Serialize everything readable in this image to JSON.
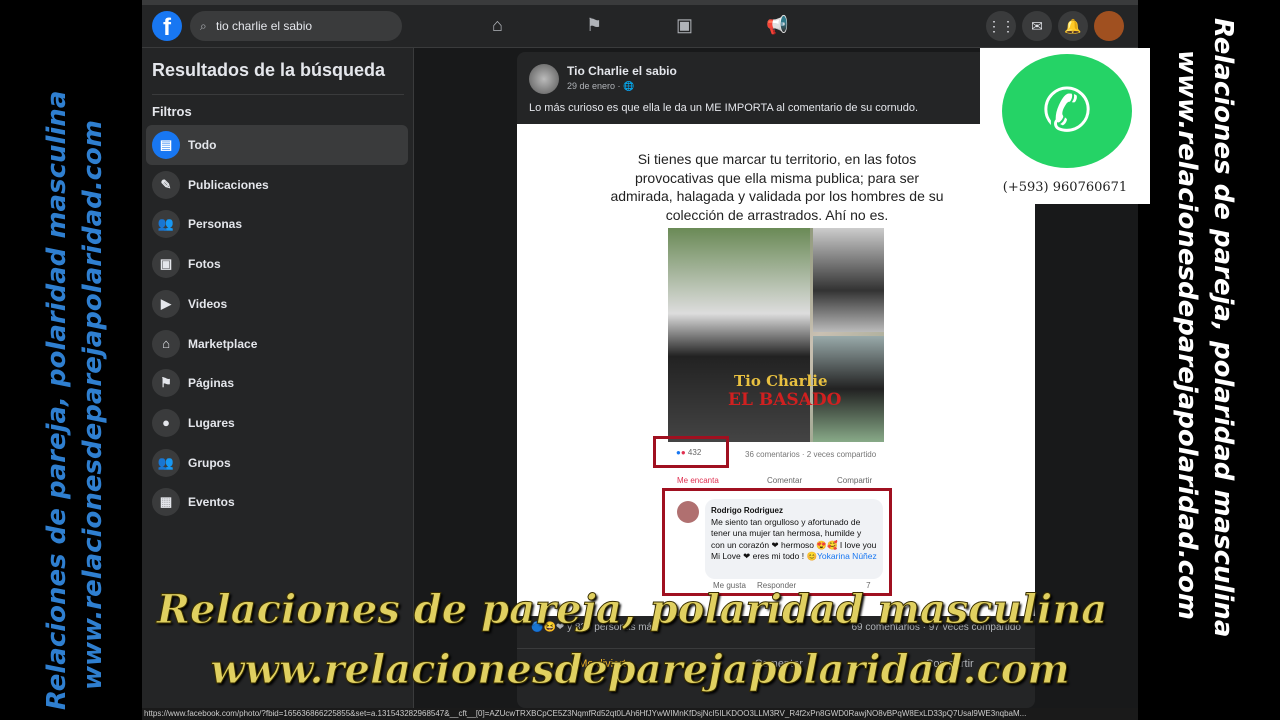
{
  "search": {
    "value": "tio charlie el sabio"
  },
  "nav": [
    "home-icon",
    "flag-icon",
    "video-icon",
    "megaphone-icon"
  ],
  "sidebar": {
    "title": "Resultados de la búsqueda",
    "filters_label": "Filtros",
    "items": [
      {
        "label": "Todo",
        "icon": "▤"
      },
      {
        "label": "Publicaciones",
        "icon": "✎"
      },
      {
        "label": "Personas",
        "icon": "👥"
      },
      {
        "label": "Fotos",
        "icon": "▣"
      },
      {
        "label": "Videos",
        "icon": "▶"
      },
      {
        "label": "Marketplace",
        "icon": "⌂"
      },
      {
        "label": "Páginas",
        "icon": "⚑"
      },
      {
        "label": "Lugares",
        "icon": "●"
      },
      {
        "label": "Grupos",
        "icon": "👥"
      },
      {
        "label": "Eventos",
        "icon": "▦"
      }
    ]
  },
  "post": {
    "author": "Tio Charlie el sabio",
    "date": "29 de enero · 🌐",
    "text": "Lo más curioso es que ella le da un ME IMPORTA al comentario de su cornudo.",
    "image": {
      "quote": "Si tienes que marcar tu territorio, en las fotos provocativas que ella misma publica; para ser admirada, halagada y validada por los hombres de su colección de arrastrados. Ahí no es.",
      "watermark1": "Tio Charlie",
      "watermark2": "EL BASADO",
      "likes": "432",
      "stats": "36 comentarios · 2 veces compartido",
      "actions": [
        "Me encanta",
        "Comentar",
        "Compartir"
      ],
      "comment": {
        "author": "Rodrigo Rodriguez",
        "text": "Me siento tan orgulloso y afortunado de tener una mujer tan hermosa, humilde y con un corazón ❤ hermoso 😍🥰 I love you Mi Love ❤ eres mi todo ! 😊",
        "mention": "Yokarina Núñez",
        "like": "Me gusta",
        "reply": "Responder",
        "count": "7"
      }
    },
    "reactions": "y 825 personas más",
    "stats": "69 comentarios · 97 veces compartido",
    "actions": [
      "Me divierte",
      "Comentar",
      "Compartir"
    ]
  },
  "status_url": "https://www.facebook.com/photo/?fbid=165636866225855&set=a.131543282968547&__cft__[0]=AZUcwTRXBCpCE5Z3NqmfRd52qt0LAh6HfJYwWIMnKfDsjNcI5ILKDOO3LLM3RV_R4f2xPn8GWD0RawjNO8vBPqW8ExLD33pQ7Usal9WE3nqbaM...",
  "whatsapp": {
    "phone": "(+593) 960760671"
  },
  "overlay": {
    "line1": "Relaciones de pareja, polaridad masculina",
    "line2": "www.relacionesdeparejapolaridad.com"
  },
  "colors": {
    "fb_blue": "#1877f2",
    "overlay_yellow": "#e0d060",
    "side_blue": "#2f7fd0",
    "highlight_red": "#a01020"
  }
}
